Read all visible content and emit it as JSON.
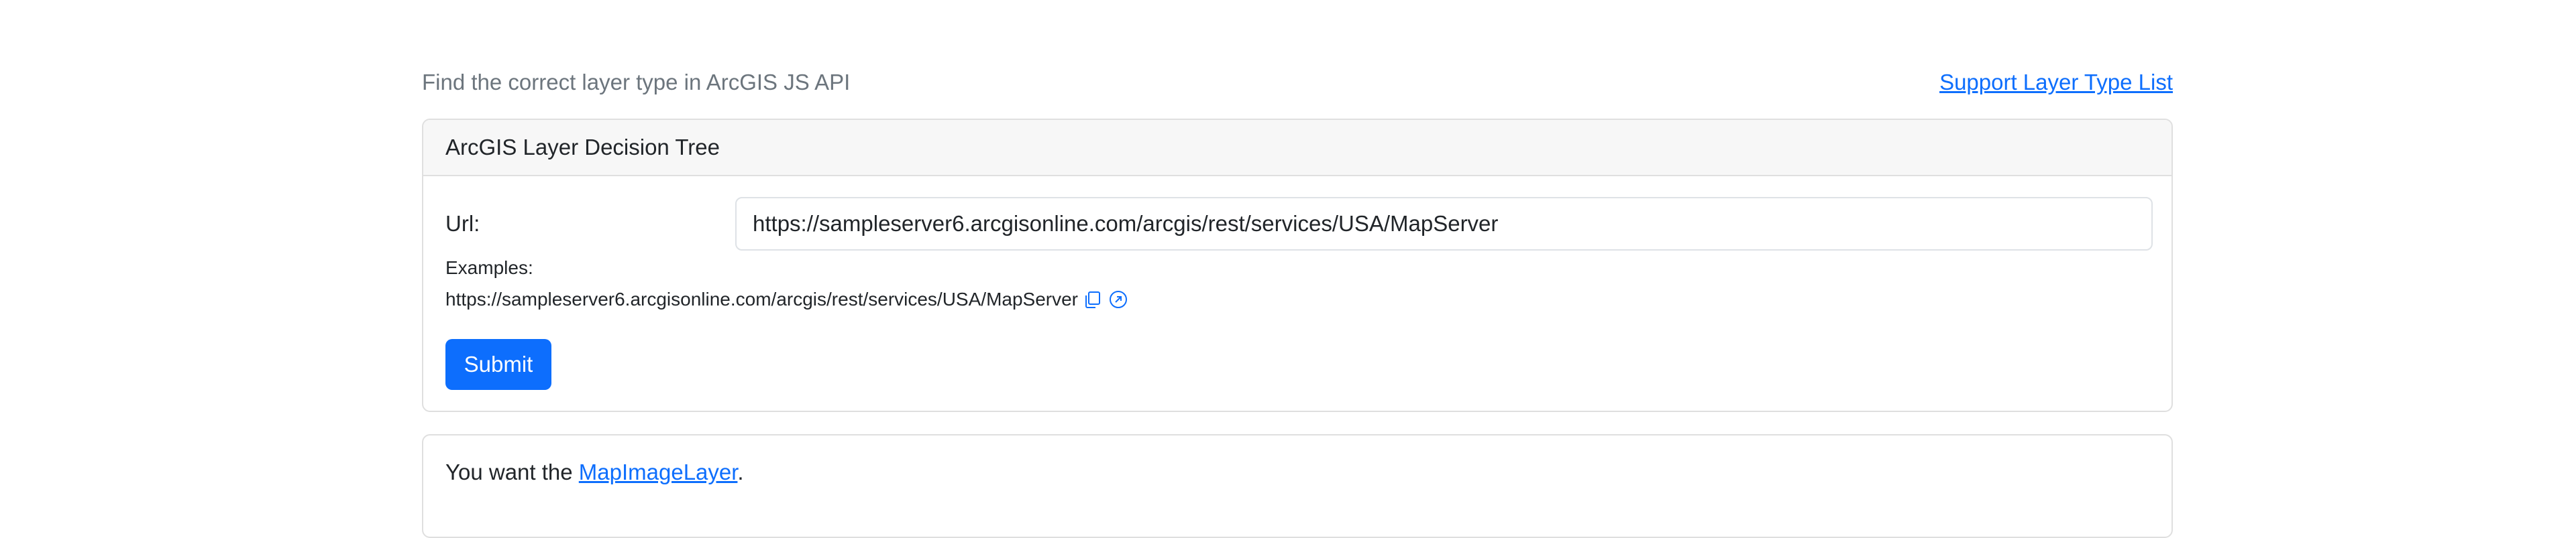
{
  "header": {
    "title": "Find the correct layer type in ArcGIS JS API",
    "support_link": "Support Layer Type List"
  },
  "card": {
    "title": "ArcGIS Layer Decision Tree",
    "url_label": "Url:",
    "url_value": "https://sampleserver6.arcgisonline.com/arcgis/rest/services/USA/MapServer",
    "examples_label": "Examples:",
    "examples": [
      {
        "url": "https://sampleserver6.arcgisonline.com/arcgis/rest/services/USA/MapServer",
        "icons": [
          "copy-icon",
          "open-link-icon"
        ]
      }
    ],
    "submit_label": "Submit"
  },
  "result": {
    "prefix": "You want the ",
    "layer_name": "MapImageLayer",
    "suffix": "."
  },
  "colors": {
    "primary": "#0d6efd",
    "muted": "#6c757d",
    "border": "#dfdfdf",
    "header_bg": "#f7f7f7"
  }
}
